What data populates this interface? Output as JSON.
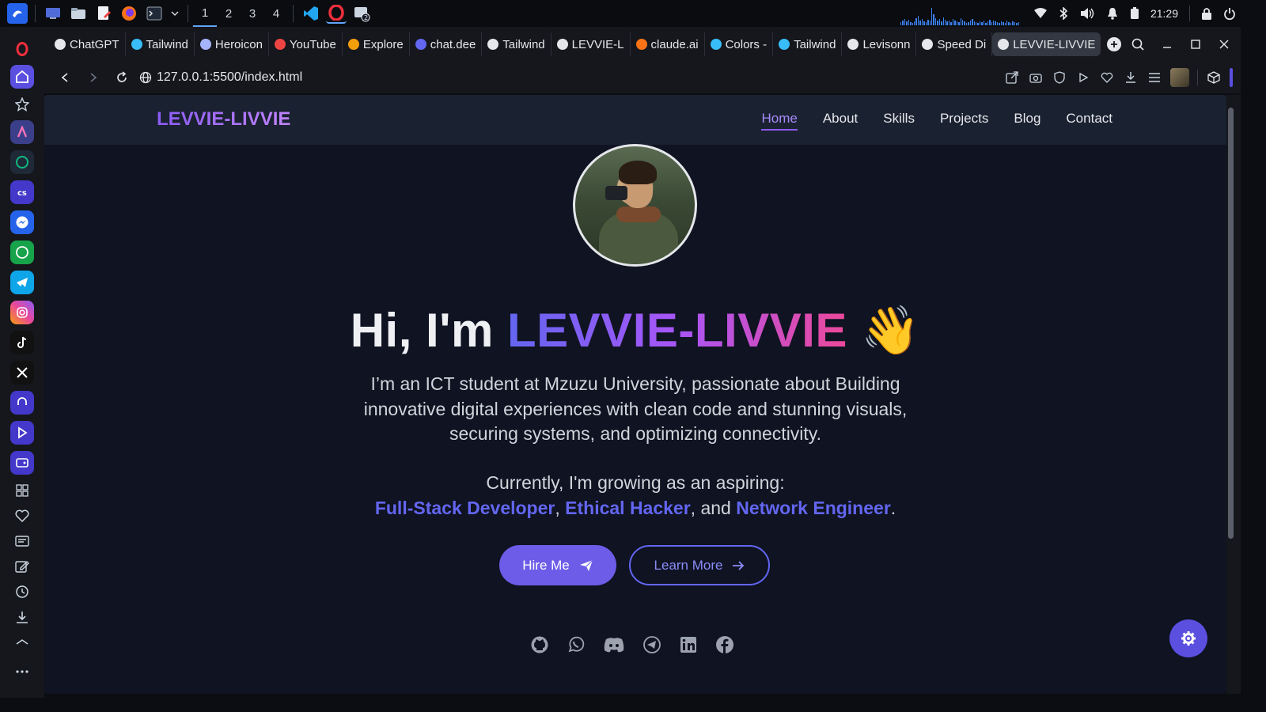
{
  "taskbar": {
    "workspaces": [
      "1",
      "2",
      "3",
      "4"
    ],
    "clock": "21:29"
  },
  "tabs": [
    {
      "label": "ChatGPT",
      "color": "#e5e7eb"
    },
    {
      "label": "Tailwind",
      "color": "#38bdf8"
    },
    {
      "label": "Heroicon",
      "color": "#a5b4fc"
    },
    {
      "label": "YouTube",
      "color": "#ef4444"
    },
    {
      "label": "Explore",
      "color": "#f59e0b"
    },
    {
      "label": "chat.dee",
      "color": "#6366f1"
    },
    {
      "label": "Tailwind",
      "color": "#e5e7eb"
    },
    {
      "label": "LEVVIE-L",
      "color": "#e5e7eb"
    },
    {
      "label": "claude.ai",
      "color": "#f97316"
    },
    {
      "label": "Colors -",
      "color": "#38bdf8"
    },
    {
      "label": "Tailwind",
      "color": "#38bdf8"
    },
    {
      "label": "Levisonn",
      "color": "#e5e7eb"
    },
    {
      "label": "Speed Di",
      "color": "#e5e7eb"
    },
    {
      "label": "LEVVIE-LIVVIE",
      "color": "#e5e7eb"
    }
  ],
  "address": {
    "url": "127.0.0.1:5500/index.html"
  },
  "site": {
    "logo": "LEVVIE-LIVVIE",
    "nav": [
      "Home",
      "About",
      "Skills",
      "Projects",
      "Blog",
      "Contact"
    ],
    "active_nav": "Home",
    "hero": {
      "greeting": "Hi, I'm ",
      "name": "LEVVIE-LIVVIE",
      "emoji": "👋",
      "description": "I’m an ICT student at Mzuzu University, passionate about Building innovative digital experiences with clean code and stunning visuals, securing systems, and optimizing connectivity.",
      "current_intro": "Currently, I'm growing as an aspiring:",
      "roles": [
        "Full-Stack Developer",
        "Ethical Hacker",
        "Network Engineer"
      ],
      "sep1": ", ",
      "sep2": ", and ",
      "end": "."
    },
    "buttons": {
      "hire": "Hire Me",
      "learn": "Learn More"
    },
    "socials": [
      "github-icon",
      "whatsapp-icon",
      "discord-icon",
      "telegram-icon",
      "linkedin-icon",
      "facebook-icon"
    ]
  },
  "colors": {
    "accent": "#6366f1",
    "page_bg": "#0f1322",
    "nav_bg": "#1a2130"
  }
}
